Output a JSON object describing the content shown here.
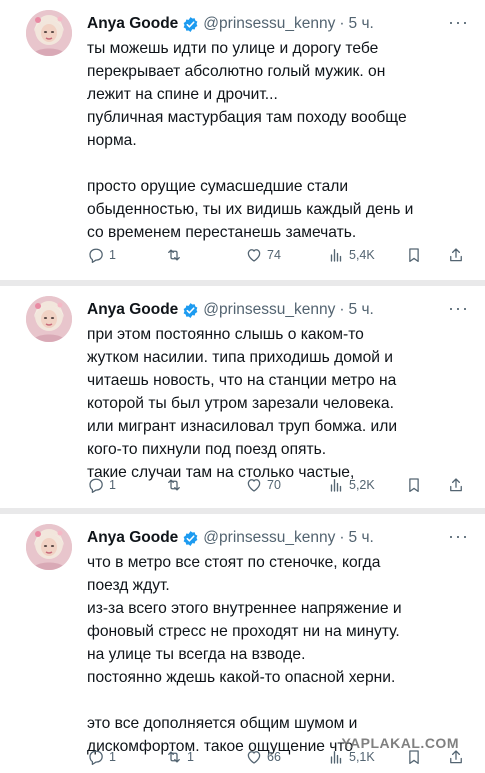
{
  "tweets": [
    {
      "author": {
        "name": "Anya Goode",
        "handle": "@prinsessu_kenny",
        "time": "5 ч."
      },
      "lines": [
        "ты можешь идти по улице и дорогу тебе",
        "перекрывает абсолютно голый мужик. он",
        "лежит на спине и дрочит...",
        "публичная мастурбация там походу вообще",
        "норма.",
        "",
        "просто орущие сумасшедшие стали",
        "обыденностью, ты их видишь каждый день и",
        "со временем перестанешь замечать."
      ],
      "stats": {
        "replies": "1",
        "reposts": "",
        "likes": "74",
        "views": "5,4K"
      }
    },
    {
      "author": {
        "name": "Anya Goode",
        "handle": "@prinsessu_kenny",
        "time": "5 ч."
      },
      "lines": [
        "при этом постоянно слышь о каком-то",
        "жутком насилии. типа приходишь домой и",
        "читаешь новость, что на станции метро на",
        "которой ты был утром зарезали человека.",
        "или мигрант изнасиловал труп бомжа. или",
        "кого-то пихнули под поезд опять.",
        "такие случаи там на столько частые,"
      ],
      "stats": {
        "replies": "1",
        "reposts": "",
        "likes": "70",
        "views": "5,2K"
      }
    },
    {
      "author": {
        "name": "Anya Goode",
        "handle": "@prinsessu_kenny",
        "time": "5 ч."
      },
      "lines": [
        "что в метро все стоят по стеночке, когда",
        "поезд ждут.",
        "из-за всего этого внутреннее напряжение и",
        "фоновый стресс не проходят ни на минуту.",
        "на улице ты всегда на взводе.",
        "постоянно ждешь какой-то опасной херни.",
        "",
        "это все дополняется общим шумом и",
        "дискомфортом. такое ощущение что"
      ],
      "stats": {
        "replies": "1",
        "reposts": "1",
        "likes": "66",
        "views": "5,1K"
      }
    }
  ],
  "watermark": "YAPLAKAL.COM",
  "colors": {
    "text": "#0f1419",
    "muted": "#536471",
    "verified": "#1d9bf0",
    "separator": "#e9e9ea"
  }
}
